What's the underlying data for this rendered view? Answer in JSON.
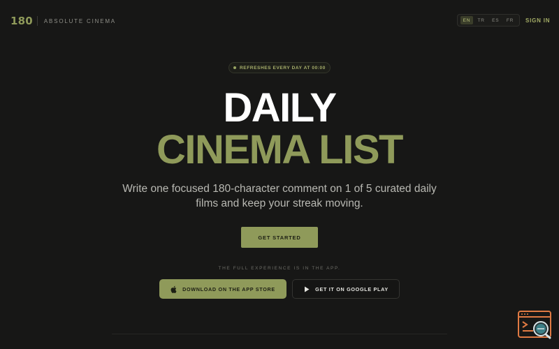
{
  "header": {
    "logo": "180",
    "subtitle": "ABSOLUTE CINEMA",
    "languages": [
      {
        "code": "EN",
        "active": true
      },
      {
        "code": "TR",
        "active": false
      },
      {
        "code": "ES",
        "active": false
      },
      {
        "code": "FR",
        "active": false
      }
    ],
    "sign_in": "SIGN IN"
  },
  "badge": {
    "text": "REFRESHES EVERY DAY AT 00:00"
  },
  "hero": {
    "line1": "DAILY",
    "line2": "CINEMA LIST",
    "subtitle": "Write one focused 180-character comment on 1 of 5 curated daily films and keep your streak moving.",
    "cta_label": "GET STARTED"
  },
  "apps": {
    "note": "THE FULL EXPERIENCE IS IN THE APP.",
    "app_store_label": "DOWNLOAD ON THE APP STORE",
    "google_play_label": "GET IT ON GOOGLE PLAY"
  },
  "colors": {
    "background": "#171716",
    "accent": "#8f9a5a",
    "widget_orange": "#e07a43"
  },
  "icons": {
    "app_store": "apple-icon",
    "google_play": "play-icon",
    "corner": "terminal-search-icon"
  }
}
